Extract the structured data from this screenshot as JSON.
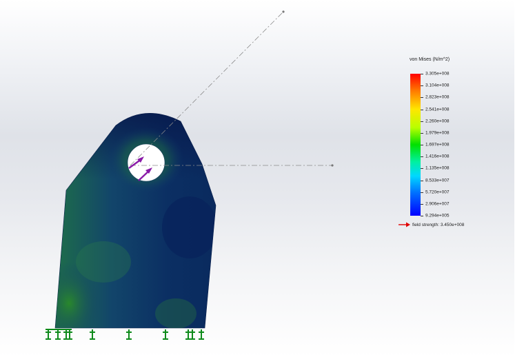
{
  "legend": {
    "title": "von Mises (N/m^2)",
    "ticks": [
      "3.305e+008",
      "3.104e+008",
      "2.823e+008",
      "2.541e+008",
      "2.260e+008",
      "1.979e+008",
      "1.697e+008",
      "1.416e+008",
      "1.135e+008",
      "8.533e+007",
      "5.720e+007",
      "2.906e+007",
      "9.294e+005"
    ],
    "field_strength": "field strength: 3.450e+008"
  },
  "colors": {
    "plate_base": "#123a6e",
    "plate_dark": "#061a4d",
    "plate_green": "#1f7a2a",
    "load_arrow": "#8a1aa8",
    "fixture": "#0d8a1a",
    "field_arrow": "#e00000"
  }
}
